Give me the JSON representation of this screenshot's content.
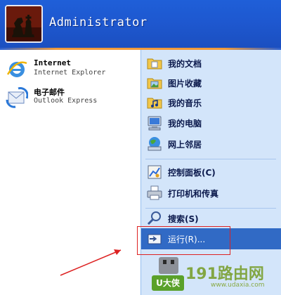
{
  "header": {
    "username": "Administrator"
  },
  "left_programs": [
    {
      "title": "Internet",
      "subtitle": "Internet Explorer",
      "icon": "internet-explorer-icon"
    },
    {
      "title": "电子邮件",
      "subtitle": "Outlook Express",
      "icon": "outlook-express-icon"
    }
  ],
  "right_items": [
    {
      "label": "我的文档",
      "icon": "my-documents-icon"
    },
    {
      "label": "图片收藏",
      "icon": "my-pictures-icon"
    },
    {
      "label": "我的音乐",
      "icon": "my-music-icon"
    },
    {
      "label": "我的电脑",
      "icon": "my-computer-icon"
    },
    {
      "label": "网上邻居",
      "icon": "network-places-icon"
    },
    {
      "label": "控制面板(C)",
      "icon": "control-panel-icon"
    },
    {
      "label": "打印机和传真",
      "icon": "printers-faxes-icon"
    },
    {
      "label": "搜索(S)",
      "icon": "search-icon"
    },
    {
      "label": "运行(R)...",
      "icon": "run-icon"
    }
  ],
  "watermark": {
    "brand": "U大侠",
    "site": "191路由网",
    "url": "www.udaxia.com"
  },
  "colors": {
    "header_blue": "#1f5fd8",
    "right_panel": "#d3e5fa",
    "selection": "#316ac5",
    "highlight_box": "#dd2222"
  }
}
